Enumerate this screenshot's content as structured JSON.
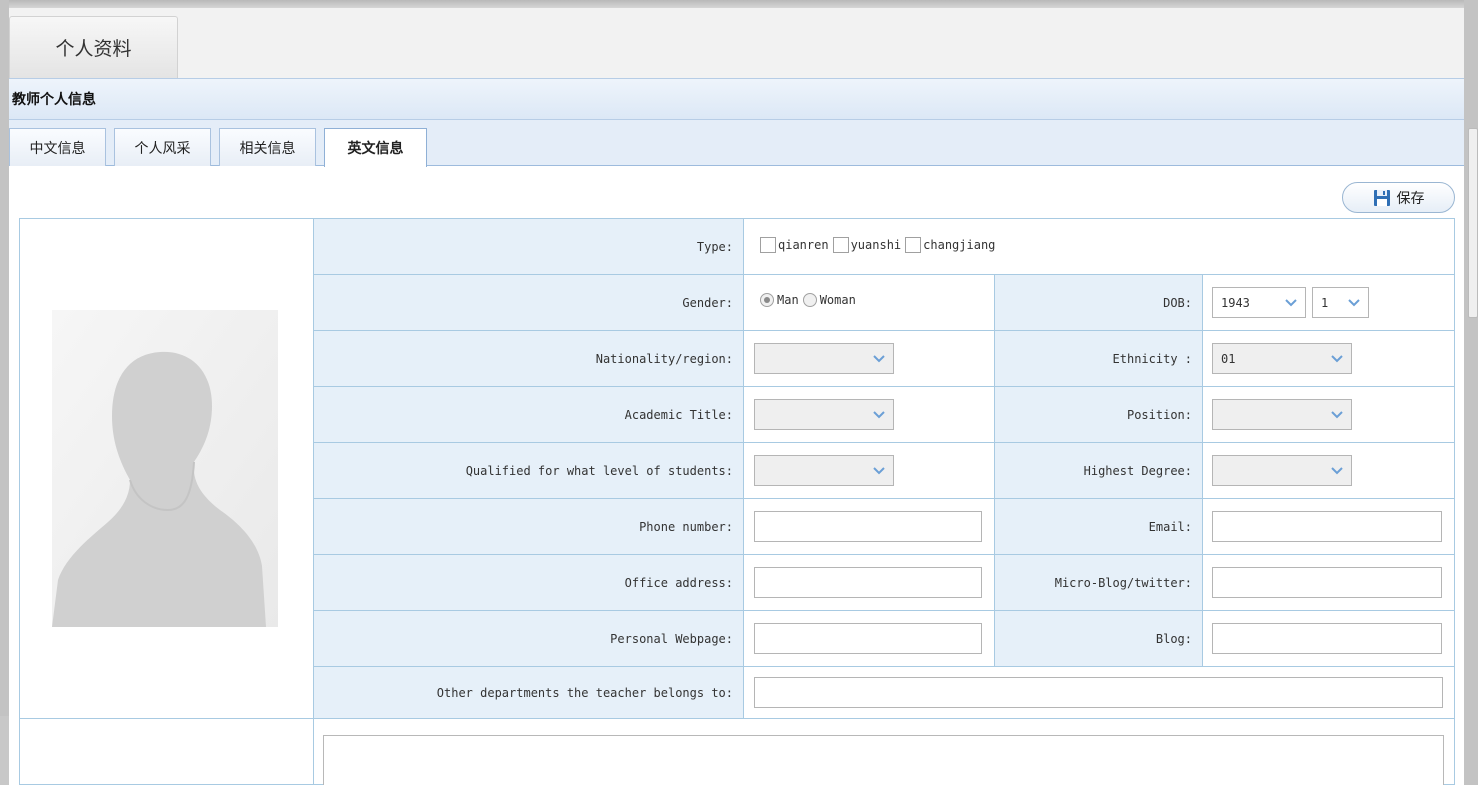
{
  "page_tab": {
    "label": "个人资料"
  },
  "panel": {
    "title": "教师个人信息"
  },
  "subtabs": [
    {
      "label": "中文信息"
    },
    {
      "label": "个人风采"
    },
    {
      "label": "相关信息"
    },
    {
      "label": "英文信息",
      "active": true
    }
  ],
  "toolbar": {
    "save_label": "保存",
    "save_icon": "floppy-disk-icon"
  },
  "form": {
    "type": {
      "label": "Type:",
      "options": [
        "qianren",
        "yuanshi",
        "changjiang"
      ]
    },
    "gender": {
      "label": "Gender:",
      "options": [
        "Man",
        "Woman"
      ],
      "selected": "Man"
    },
    "dob": {
      "label": "DOB:",
      "year": "1943",
      "month": "1"
    },
    "nationality": {
      "label": "Nationality/region:",
      "value": ""
    },
    "ethnicity": {
      "label": "Ethnicity :",
      "value": "01"
    },
    "academic_title": {
      "label": "Academic Title:",
      "value": ""
    },
    "position": {
      "label": "Position:",
      "value": ""
    },
    "qualified": {
      "label": "Qualified for what level of students:",
      "value": ""
    },
    "highest_degree": {
      "label": "Highest Degree:",
      "value": ""
    },
    "phone": {
      "label": "Phone number:",
      "value": ""
    },
    "email": {
      "label": "Email:",
      "value": ""
    },
    "office": {
      "label": "Office address:",
      "value": ""
    },
    "microblog": {
      "label": "Micro-Blog/twitter:",
      "value": ""
    },
    "webpage": {
      "label": "Personal Webpage:",
      "value": ""
    },
    "blog": {
      "label": "Blog:",
      "value": ""
    },
    "departments": {
      "label": "Other departments the teacher belongs to:",
      "value": ""
    }
  },
  "colors": {
    "label_bg": "#e6f0f9",
    "border": "#a8cae2",
    "header_bg": "#dce8f6"
  }
}
